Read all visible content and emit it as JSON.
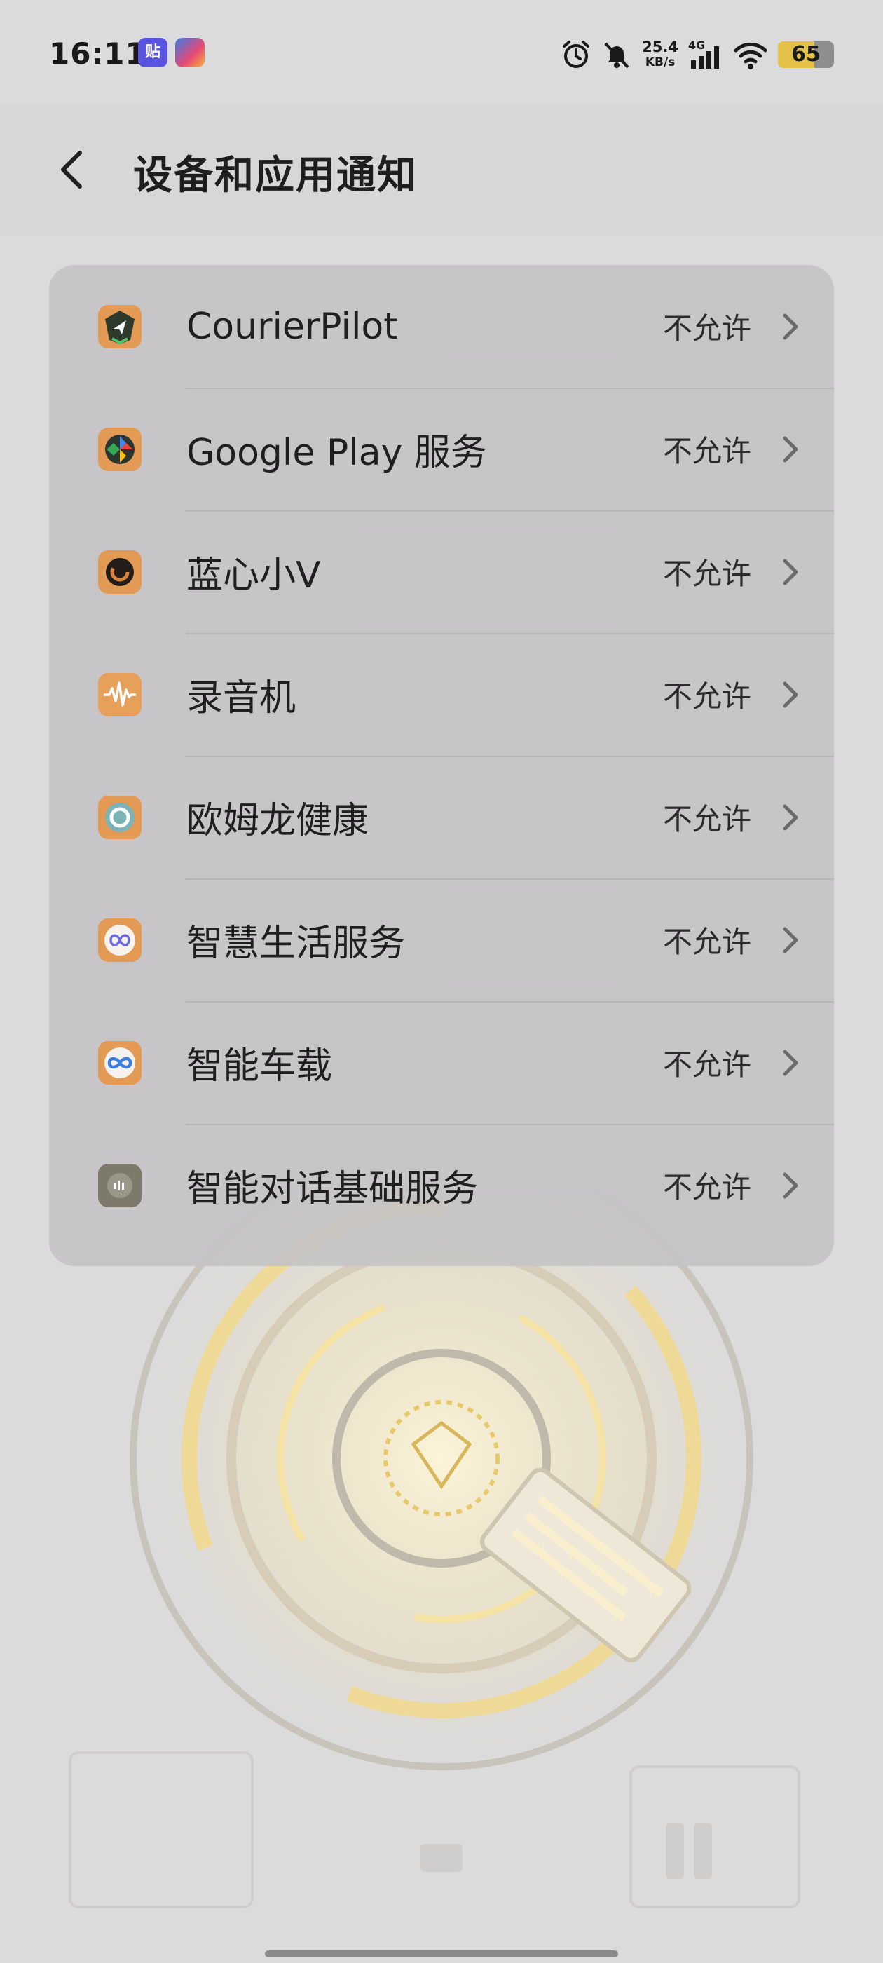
{
  "status_bar": {
    "time": "16:11",
    "notification_icons": [
      "tieba-app-icon",
      "game-app-icon"
    ],
    "notif_tie_label": "贴",
    "net_speed_value": "25.4",
    "net_speed_unit": "KB/s",
    "network_type": "4G",
    "battery_percent": "65",
    "battery_level": 0.65,
    "icons": [
      "alarm-icon",
      "mute-icon",
      "signal-icon",
      "wifi-icon",
      "battery-icon"
    ]
  },
  "header": {
    "title": "设备和应用通知",
    "back_icon": "back-arrow-icon"
  },
  "apps": [
    {
      "name": "CourierPilot",
      "status": "不允许",
      "icon": "courierpilot-app-icon",
      "color": "#3d4a3a"
    },
    {
      "name": "Google Play 服务",
      "status": "不允许",
      "icon": "google-play-services-icon",
      "color": "#2e3b36"
    },
    {
      "name": "蓝心小V",
      "status": "不允许",
      "icon": "bluecore-v-icon",
      "color": "#2b2320"
    },
    {
      "name": "录音机",
      "status": "不允许",
      "icon": "recorder-icon",
      "color": "#d9813a"
    },
    {
      "name": "欧姆龙健康",
      "status": "不允许",
      "icon": "omron-health-icon",
      "color": "#6fa8ad"
    },
    {
      "name": "智慧生活服务",
      "status": "不允许",
      "icon": "smart-life-icon",
      "color": "#f4efe8"
    },
    {
      "name": "智能车载",
      "status": "不允许",
      "icon": "smart-car-icon",
      "color": "#f2eeeb"
    },
    {
      "name": "智能对话基础服务",
      "status": "不允许",
      "icon": "dialogue-service-icon",
      "color": "#7c7868"
    }
  ],
  "colors": {
    "background": "#dcdbdc",
    "card": "#c4c3c4",
    "text": "#1f1f1f",
    "battery_fill": "#e4c24a"
  }
}
